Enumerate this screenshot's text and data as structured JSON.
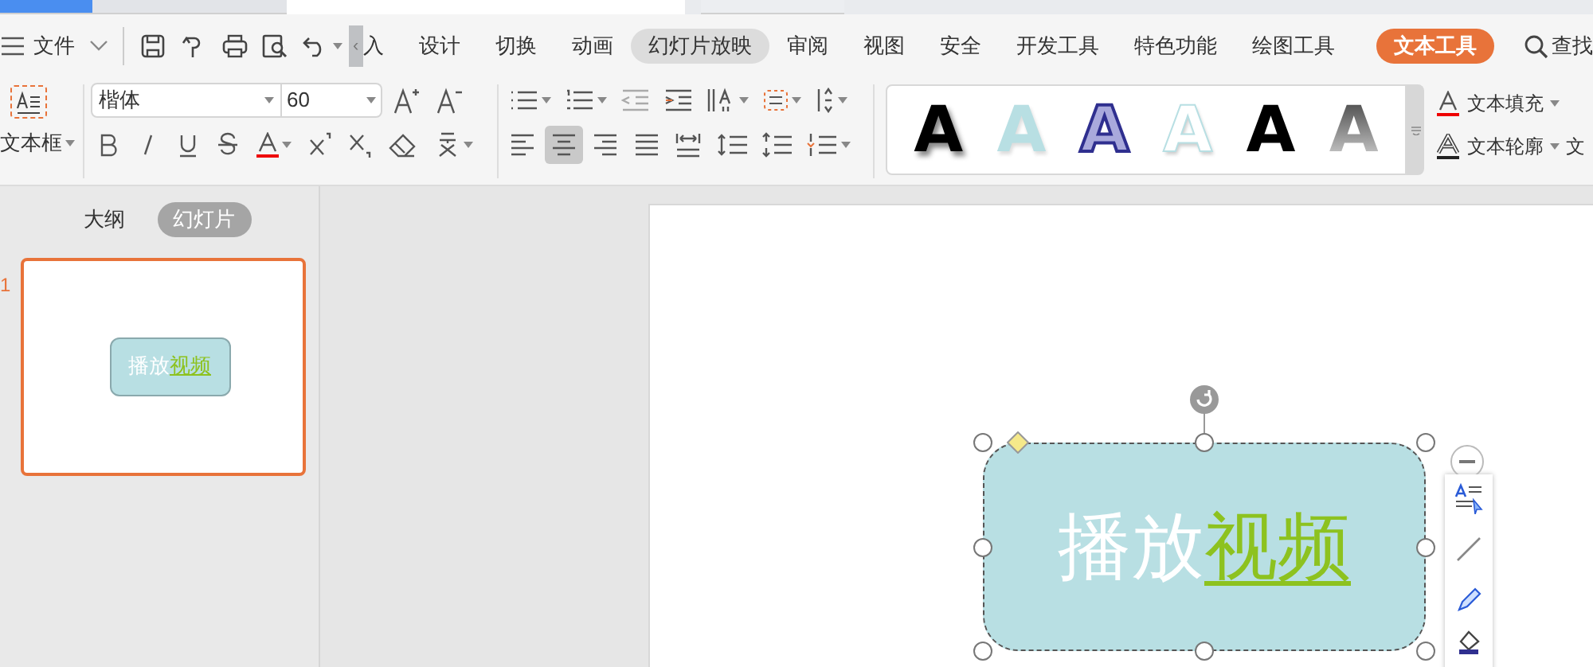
{
  "window_tabs": [
    {
      "kind": "home",
      "selected": false
    },
    {
      "kind": "template",
      "selected": false
    },
    {
      "kind": "document",
      "selected": true
    },
    {
      "kind": "new",
      "selected": false
    }
  ],
  "menu": {
    "file": "文件",
    "scroll_label": "‹"
  },
  "ribbon_tabs": [
    {
      "label": "入",
      "selected": false,
      "hovered": false,
      "kind": "normal"
    },
    {
      "label": "设计",
      "selected": false,
      "hovered": false,
      "kind": "normal"
    },
    {
      "label": "切换",
      "selected": false,
      "hovered": false,
      "kind": "normal"
    },
    {
      "label": "动画",
      "selected": false,
      "hovered": false,
      "kind": "normal"
    },
    {
      "label": "幻灯片放映",
      "selected": false,
      "hovered": true,
      "kind": "normal"
    },
    {
      "label": "审阅",
      "selected": false,
      "hovered": false,
      "kind": "normal"
    },
    {
      "label": "视图",
      "selected": false,
      "hovered": false,
      "kind": "normal"
    },
    {
      "label": "安全",
      "selected": false,
      "hovered": false,
      "kind": "normal"
    },
    {
      "label": "开发工具",
      "selected": false,
      "hovered": false,
      "kind": "normal"
    },
    {
      "label": "特色功能",
      "selected": false,
      "hovered": false,
      "kind": "normal"
    },
    {
      "label": "绘图工具",
      "selected": false,
      "hovered": false,
      "kind": "normal"
    },
    {
      "label": "文本工具",
      "selected": true,
      "hovered": false,
      "kind": "context"
    }
  ],
  "search": {
    "label": "查找"
  },
  "ribbon": {
    "textbox": "文本框",
    "font": "楷体",
    "size": "60",
    "alignment": [
      {
        "kind": "left",
        "selected": false
      },
      {
        "kind": "center",
        "selected": true
      },
      {
        "kind": "right",
        "selected": false
      },
      {
        "kind": "justify",
        "selected": false
      },
      {
        "kind": "distributed",
        "selected": false
      }
    ],
    "wordart_styles": [
      {
        "label": "A",
        "kind": "black-shadow"
      },
      {
        "label": "A",
        "kind": "light-blue"
      },
      {
        "label": "A",
        "kind": "navy-outline"
      },
      {
        "label": "A",
        "kind": "white-outline"
      },
      {
        "label": "A",
        "kind": "black"
      },
      {
        "label": "A",
        "kind": "gray-gradient"
      }
    ],
    "text_fill": "文本填充",
    "text_outline": "文本轮廓",
    "text_more": "文"
  },
  "panel": {
    "tabs": [
      {
        "label": "大纲",
        "selected": false
      },
      {
        "label": "幻灯片",
        "selected": true
      }
    ],
    "slides": [
      {
        "number": "1",
        "selected": true,
        "parts": [
          {
            "text": "播放",
            "kind": "plain"
          },
          {
            "text": "视频",
            "kind": "link"
          }
        ]
      }
    ]
  },
  "slide": {
    "shape": {
      "selected": true,
      "parts": [
        {
          "text": "播放",
          "kind": "plain"
        },
        {
          "text": "视频",
          "kind": "link"
        }
      ]
    }
  }
}
